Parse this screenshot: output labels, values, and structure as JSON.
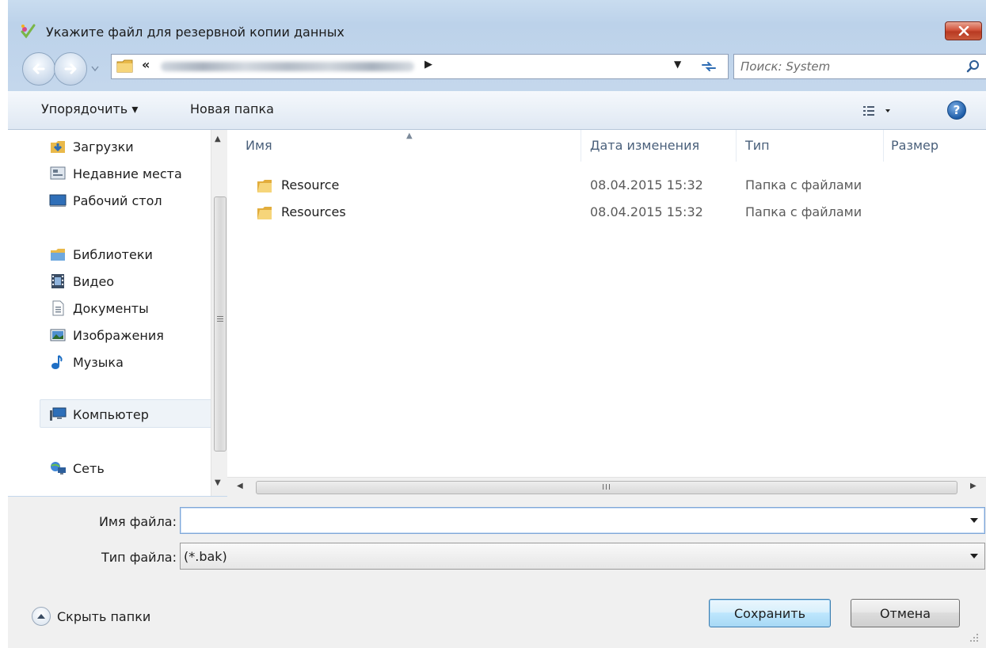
{
  "window": {
    "title": "Укажите файл для резервной копии данных"
  },
  "nav_bar": {
    "address_chevron": "«",
    "search_placeholder": "Поиск: System"
  },
  "toolbar": {
    "organize_label": "Упорядочить ▾",
    "new_folder_label": "Новая папка"
  },
  "sidebar": {
    "items": [
      {
        "label": "Загрузки",
        "icon": "downloads-icon"
      },
      {
        "label": "Недавние места",
        "icon": "recent-places-icon"
      },
      {
        "label": "Рабочий стол",
        "icon": "desktop-icon"
      },
      {
        "label": "Библиотеки",
        "icon": "libraries-icon"
      },
      {
        "label": "Видео",
        "icon": "video-icon"
      },
      {
        "label": "Документы",
        "icon": "documents-icon"
      },
      {
        "label": "Изображения",
        "icon": "pictures-icon"
      },
      {
        "label": "Музыка",
        "icon": "music-icon"
      },
      {
        "label": "Компьютер",
        "icon": "computer-icon",
        "selected": true
      },
      {
        "label": "Сеть",
        "icon": "network-icon"
      }
    ]
  },
  "file_list": {
    "columns": [
      "Имя",
      "Дата изменения",
      "Тип",
      "Размер"
    ],
    "rows": [
      {
        "name": "Resource",
        "date": "08.04.2015 15:32",
        "type": "Папка с файлами",
        "size": ""
      },
      {
        "name": "Resources",
        "date": "08.04.2015 15:32",
        "type": "Папка с файлами",
        "size": ""
      }
    ],
    "scroll_marker": "III"
  },
  "form": {
    "filename_label": "Имя файла:",
    "filename_value": "",
    "filetype_label": "Тип файла:",
    "filetype_value": "(*.bak)"
  },
  "footer": {
    "hide_folders_label": "Скрыть папки",
    "save_label": "Сохранить",
    "cancel_label": "Отмена"
  },
  "colors": {
    "close_button": "#c9452b",
    "accent": "#3c7fb1",
    "column_header": "#4a607b"
  }
}
